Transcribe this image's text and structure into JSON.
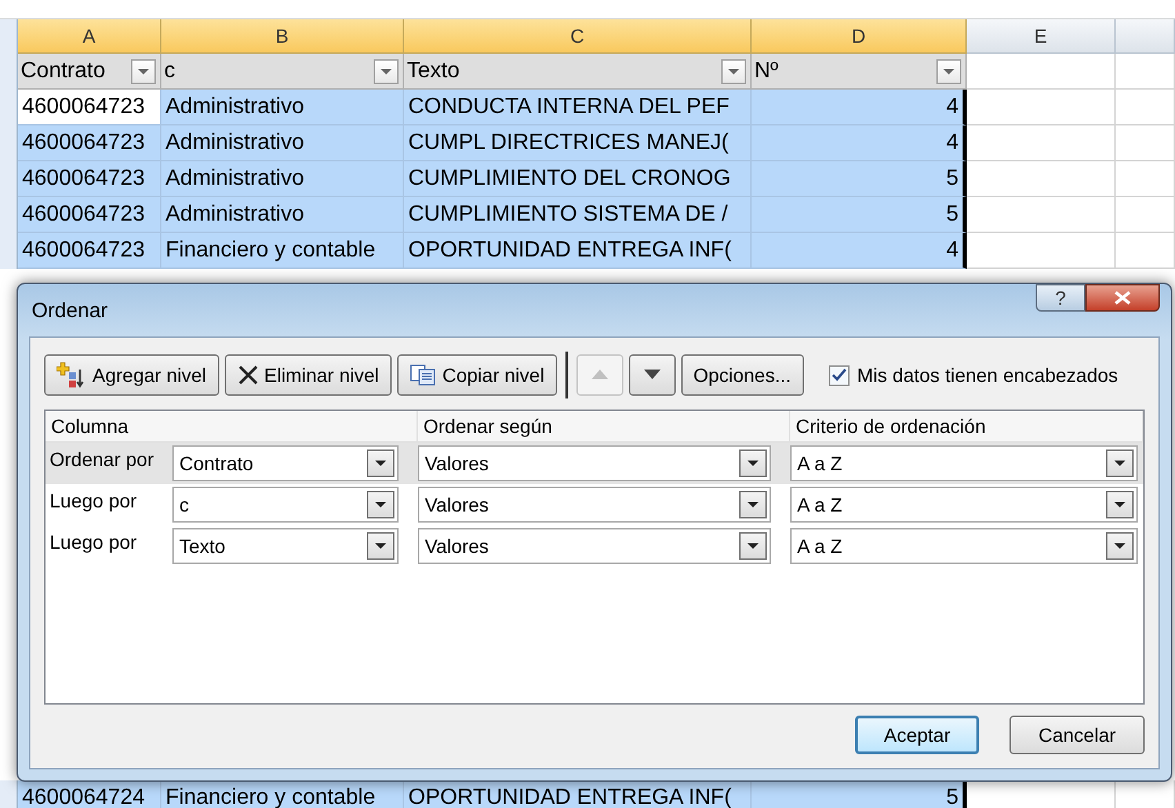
{
  "sheet": {
    "column_letters": [
      "A",
      "B",
      "C",
      "D",
      "E"
    ],
    "header": [
      {
        "text": "Contrato",
        "filter": true
      },
      {
        "text": "c",
        "filter": true
      },
      {
        "text": "Texto",
        "filter": true
      },
      {
        "text": "Nº",
        "filter": true
      }
    ],
    "rows": [
      {
        "cells": [
          "4600064723",
          "Administrativo",
          "CONDUCTA INTERNA DEL PEF",
          "4"
        ],
        "selected": true
      },
      {
        "cells": [
          "4600064723",
          "Administrativo",
          "CUMPL DIRECTRICES MANEJ(",
          "4"
        ],
        "selected": true
      },
      {
        "cells": [
          "4600064723",
          "Administrativo",
          "CUMPLIMIENTO DEL CRONOG",
          "5"
        ],
        "selected": true
      },
      {
        "cells": [
          "4600064723",
          "Administrativo",
          "CUMPLIMIENTO SISTEMA DE /",
          "5"
        ],
        "selected": true
      },
      {
        "cells": [
          "4600064723",
          "Financiero y contable",
          "OPORTUNIDAD ENTREGA INF(",
          "4"
        ],
        "selected": true
      }
    ],
    "bottom_row": {
      "cells": [
        "4600064724",
        "Financiero y contable",
        "OPORTUNIDAD ENTREGA INF(",
        "5"
      ],
      "selected": true
    }
  },
  "dialog": {
    "title": "Ordenar",
    "help": "?",
    "toolbar": [
      {
        "kind": "add",
        "label": "Agregar nivel"
      },
      {
        "kind": "delete",
        "label": "Eliminar nivel"
      },
      {
        "kind": "copy",
        "label": "Copiar nivel"
      },
      {
        "kind": "up",
        "disabled": true
      },
      {
        "kind": "down",
        "disabled": false
      },
      {
        "kind": "plain",
        "label": "Opciones..."
      }
    ],
    "headers_checkbox": {
      "label": "Mis datos tienen encabezados",
      "checked": true
    },
    "columns": [
      "Columna",
      "Ordenar según",
      "Criterio de ordenación"
    ],
    "levels": [
      {
        "label": "Ordenar por",
        "column": "Contrato",
        "sort_on": "Valores",
        "order": "A a Z",
        "selected": true
      },
      {
        "label": "Luego por",
        "column": "c",
        "sort_on": "Valores",
        "order": "A a Z",
        "selected": false
      },
      {
        "label": "Luego por",
        "column": "Texto",
        "sort_on": "Valores",
        "order": "A a Z",
        "selected": false
      }
    ],
    "buttons": [
      {
        "label": "Aceptar",
        "default": true
      },
      {
        "label": "Cancelar",
        "default": false
      }
    ]
  }
}
